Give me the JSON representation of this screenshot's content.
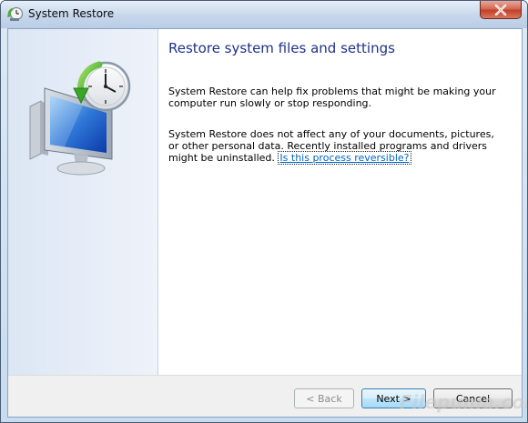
{
  "window": {
    "title": "System Restore"
  },
  "icons": {
    "title_icon": "system-restore-icon",
    "illustration": "computer-clock-restore-icon",
    "close": "close-icon"
  },
  "content": {
    "heading": "Restore system files and settings",
    "paragraph1": "System Restore can help fix problems that might be making your computer run slowly or stop responding.",
    "paragraph2": "System Restore does not affect any of your documents, pictures, or other personal data. Recently installed programs and drivers might be uninstalled.",
    "help_link": "Is this process reversible?"
  },
  "buttons": {
    "back": "< Back",
    "next": "Next >",
    "cancel": "Cancel"
  },
  "watermark": "Filepuma.com",
  "colors": {
    "heading": "#1e3287",
    "link": "#0066cc",
    "close_button": "#c0412a"
  }
}
